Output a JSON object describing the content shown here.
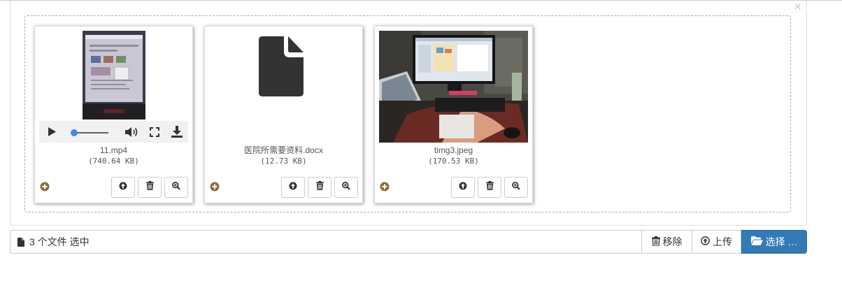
{
  "preview": {
    "close_symbol": "×",
    "files": [
      {
        "type": "video",
        "filename": "11.mp4",
        "size": "(740.64 KB)",
        "icons": [
          "play-icon",
          "volume-icon",
          "fullscreen-icon",
          "download-icon"
        ],
        "progress": 0.04
      },
      {
        "type": "document",
        "filename": "医院所需要资料.docx",
        "size": "(12.73 KB)",
        "icons": [
          "file-document-icon"
        ]
      },
      {
        "type": "image",
        "filename": "timg3.jpeg",
        "size": "(170.53 KB)",
        "icons": [
          "photo-icon"
        ]
      }
    ],
    "action_icons": [
      "upload-icon",
      "trash-icon",
      "zoom-icon"
    ],
    "indicator_icon": "plus-circle-icon",
    "colors": {
      "indicator": "#8a6d3b",
      "shadow": "#a2958a"
    }
  },
  "input_group": {
    "caption": "3 个文件 选中",
    "remove_label": "移除",
    "upload_label": "上传",
    "browse_label": "选择 …",
    "colors": {
      "primary": "#337ab7",
      "primary_border": "#2e6da4"
    }
  }
}
